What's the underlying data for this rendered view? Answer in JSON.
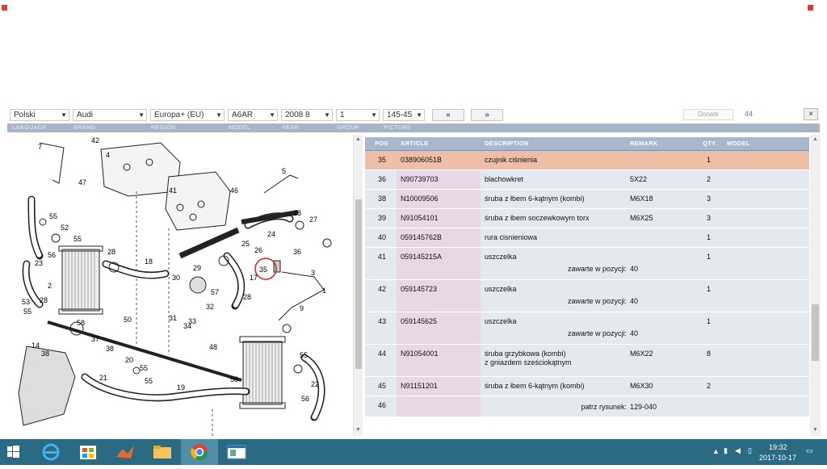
{
  "toolbar": {
    "language": "Polski",
    "brand": "Audi",
    "region": "Europa+ (EU)",
    "model": "A6AR",
    "year": "2008",
    "year_sub": "8",
    "group": "1",
    "picture": "145-45",
    "prev": "«",
    "next": "»",
    "donate": "Donate",
    "count": "44",
    "close": "×",
    "labels": {
      "language": "LANGUAGE",
      "brand": "BRAND",
      "region": "REGION",
      "model": "MODEL",
      "year": "YEAR",
      "group": "GROUP",
      "picture": "PICTURE"
    }
  },
  "diagram": {
    "callouts": [
      "7",
      "42",
      "4",
      "47",
      "41",
      "46",
      "5",
      "55",
      "52",
      "55",
      "28",
      "56",
      "23",
      "2",
      "53",
      "55",
      "28",
      "18",
      "29",
      "30",
      "57",
      "31",
      "32",
      "33",
      "34",
      "35",
      "36",
      "17",
      "26",
      "28",
      "24",
      "27",
      "25",
      "28",
      "3",
      "9",
      "1",
      "58",
      "37",
      "38",
      "38",
      "50",
      "48",
      "14",
      "21",
      "20",
      "55",
      "19",
      "55",
      "22",
      "58",
      "55",
      "56",
      "8",
      "11",
      "12",
      "16",
      "15",
      "45"
    ]
  },
  "table": {
    "headers": {
      "pos": "POS",
      "article": "ARTICLE",
      "description": "DESCRIPTION",
      "remark": "REMARK",
      "qty": "QTY",
      "model": "MODEL"
    },
    "rows": [
      {
        "pos": "35",
        "article": "038906051B",
        "desc": "czujnik ciśnienia",
        "desc2": "",
        "remark": "",
        "qty": "1",
        "note_label": "",
        "note_value": ""
      },
      {
        "pos": "36",
        "article": "N90739703",
        "desc": "blachowkret",
        "desc2": "",
        "remark": "5X22",
        "qty": "2",
        "note_label": "",
        "note_value": ""
      },
      {
        "pos": "38",
        "article": "N10009506",
        "desc": "śruba z łbem 6-kątnym (kombi)",
        "desc2": "",
        "remark": "M6X18",
        "qty": "3",
        "note_label": "",
        "note_value": ""
      },
      {
        "pos": "39",
        "article": "N91054101",
        "desc": "śruba z łbem soczewkowym torx",
        "desc2": "",
        "remark": "M6X25",
        "qty": "3",
        "note_label": "",
        "note_value": ""
      },
      {
        "pos": "40",
        "article": "059145762B",
        "desc": "rura cisnieniowa",
        "desc2": "",
        "remark": "",
        "qty": "1",
        "note_label": "",
        "note_value": ""
      },
      {
        "pos": "41",
        "article": "059145215A",
        "desc": "uszczelka",
        "desc2": "",
        "remark": "",
        "qty": "1",
        "note_label": "zawarte w pozycji:",
        "note_value": "40"
      },
      {
        "pos": "42",
        "article": "059145723",
        "desc": "uszczelka",
        "desc2": "",
        "remark": "",
        "qty": "1",
        "note_label": "zawarte w pozycji:",
        "note_value": "40"
      },
      {
        "pos": "43",
        "article": "059145625",
        "desc": "uszczelka",
        "desc2": "",
        "remark": "",
        "qty": "1",
        "note_label": "zawarte w pozycji:",
        "note_value": "40"
      },
      {
        "pos": "44",
        "article": "N91054001",
        "desc": "śruba grzybkowa (kombi)",
        "desc2": "z gniazdem sześciokątnym",
        "remark": "M6X22",
        "qty": "8",
        "note_label": "",
        "note_value": ""
      },
      {
        "pos": "45",
        "article": "N91151201",
        "desc": "śruba z łbem 6-kątnym (kombi)",
        "desc2": "",
        "remark": "M6X30",
        "qty": "2",
        "note_label": "",
        "note_value": ""
      },
      {
        "pos": "46",
        "article": "",
        "desc": "",
        "desc2": "",
        "remark": "",
        "qty": "",
        "note_label": "patrz rysunek:",
        "note_value": "129-040"
      }
    ]
  },
  "taskbar": {
    "time": "19:32",
    "date": "2017-10-17"
  },
  "colors": {
    "highlight_row": "#eebfa6",
    "row_bg": "#e4e9f1",
    "article_bg": "#e8d8e6",
    "header_bg": "#a9b7cc",
    "taskbar": "#2a6b83"
  }
}
